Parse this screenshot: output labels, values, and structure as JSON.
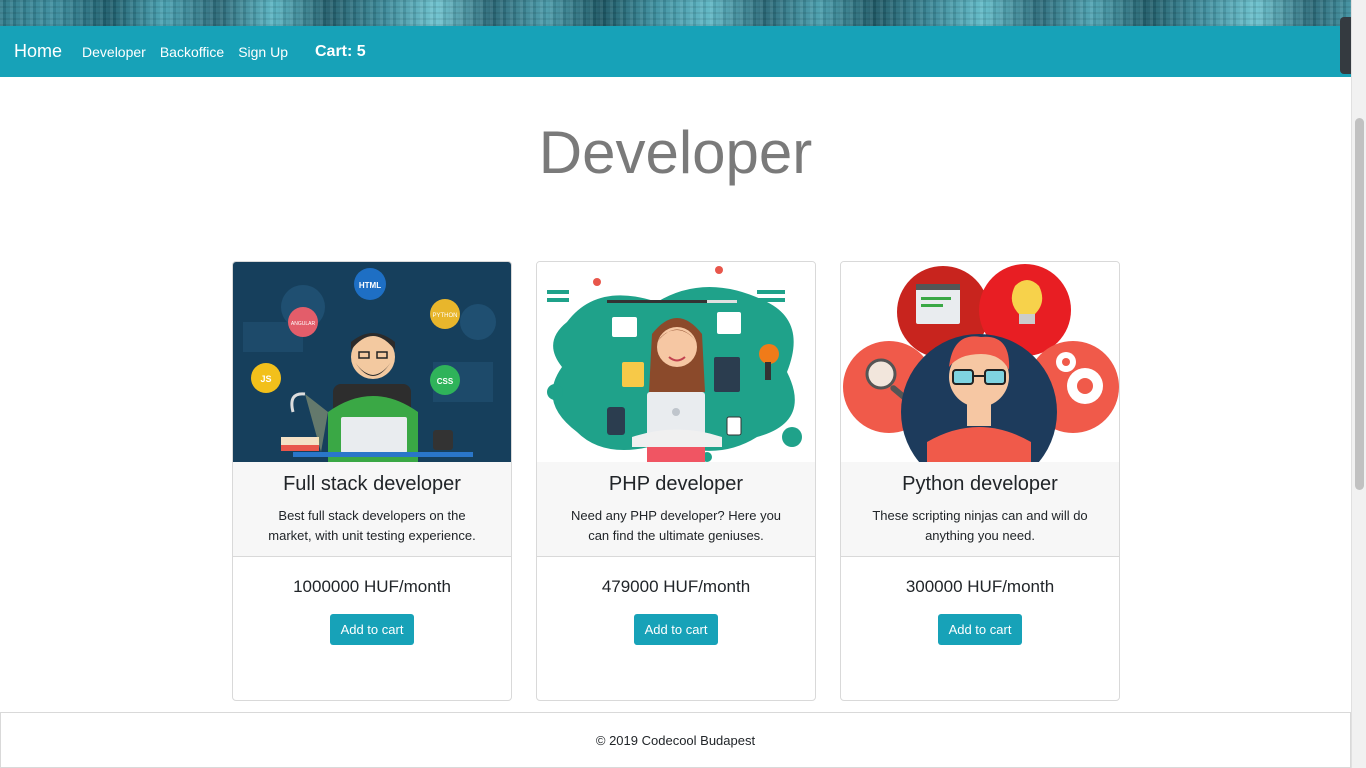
{
  "nav": {
    "brand": "Home",
    "links": [
      "Developer",
      "Backoffice",
      "Sign Up"
    ],
    "cart": "Cart: 5"
  },
  "page": {
    "title": "Developer"
  },
  "cards": [
    {
      "title": "Full stack developer",
      "description": "Best full stack developers on the market, with unit testing experience.",
      "price": "1000000 HUF/month",
      "button": "Add to cart",
      "image_bubbles": [
        "HTML",
        "PYTHON",
        "ANGULAR",
        "JS",
        "CSS"
      ]
    },
    {
      "title": "PHP developer",
      "description": "Need any PHP developer? Here you can find the ultimate geniuses.",
      "price": "479000 HUF/month",
      "button": "Add to cart"
    },
    {
      "title": "Python developer",
      "description": "These scripting ninjas can and will do anything you need.",
      "price": "300000 HUF/month",
      "button": "Add to cart"
    }
  ],
  "footer": {
    "text": "© 2019 Codecool Budapest"
  },
  "colors": {
    "primary": "#17a2b8",
    "title_gray": "#7a7a7a"
  }
}
